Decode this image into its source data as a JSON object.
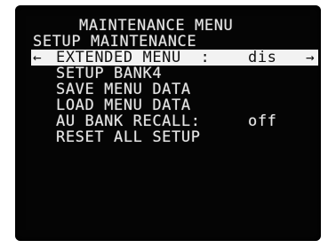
{
  "menu": {
    "title": "MAINTENANCE MENU",
    "subtitle": "SETUP MAINTENANCE",
    "items": [
      {
        "label": "EXTENDED MENU  :",
        "value": "dis",
        "selected": true
      },
      {
        "label": "SETUP BANK4",
        "value": ""
      },
      {
        "label": "SAVE MENU DATA",
        "value": ""
      },
      {
        "label": "LOAD MENU DATA",
        "value": ""
      },
      {
        "label": "AU BANK RECALL:",
        "value": "off"
      },
      {
        "label": "RESET ALL SETUP",
        "value": ""
      }
    ],
    "icons": {
      "left_arrow": "←",
      "right_arrow": "→"
    }
  }
}
